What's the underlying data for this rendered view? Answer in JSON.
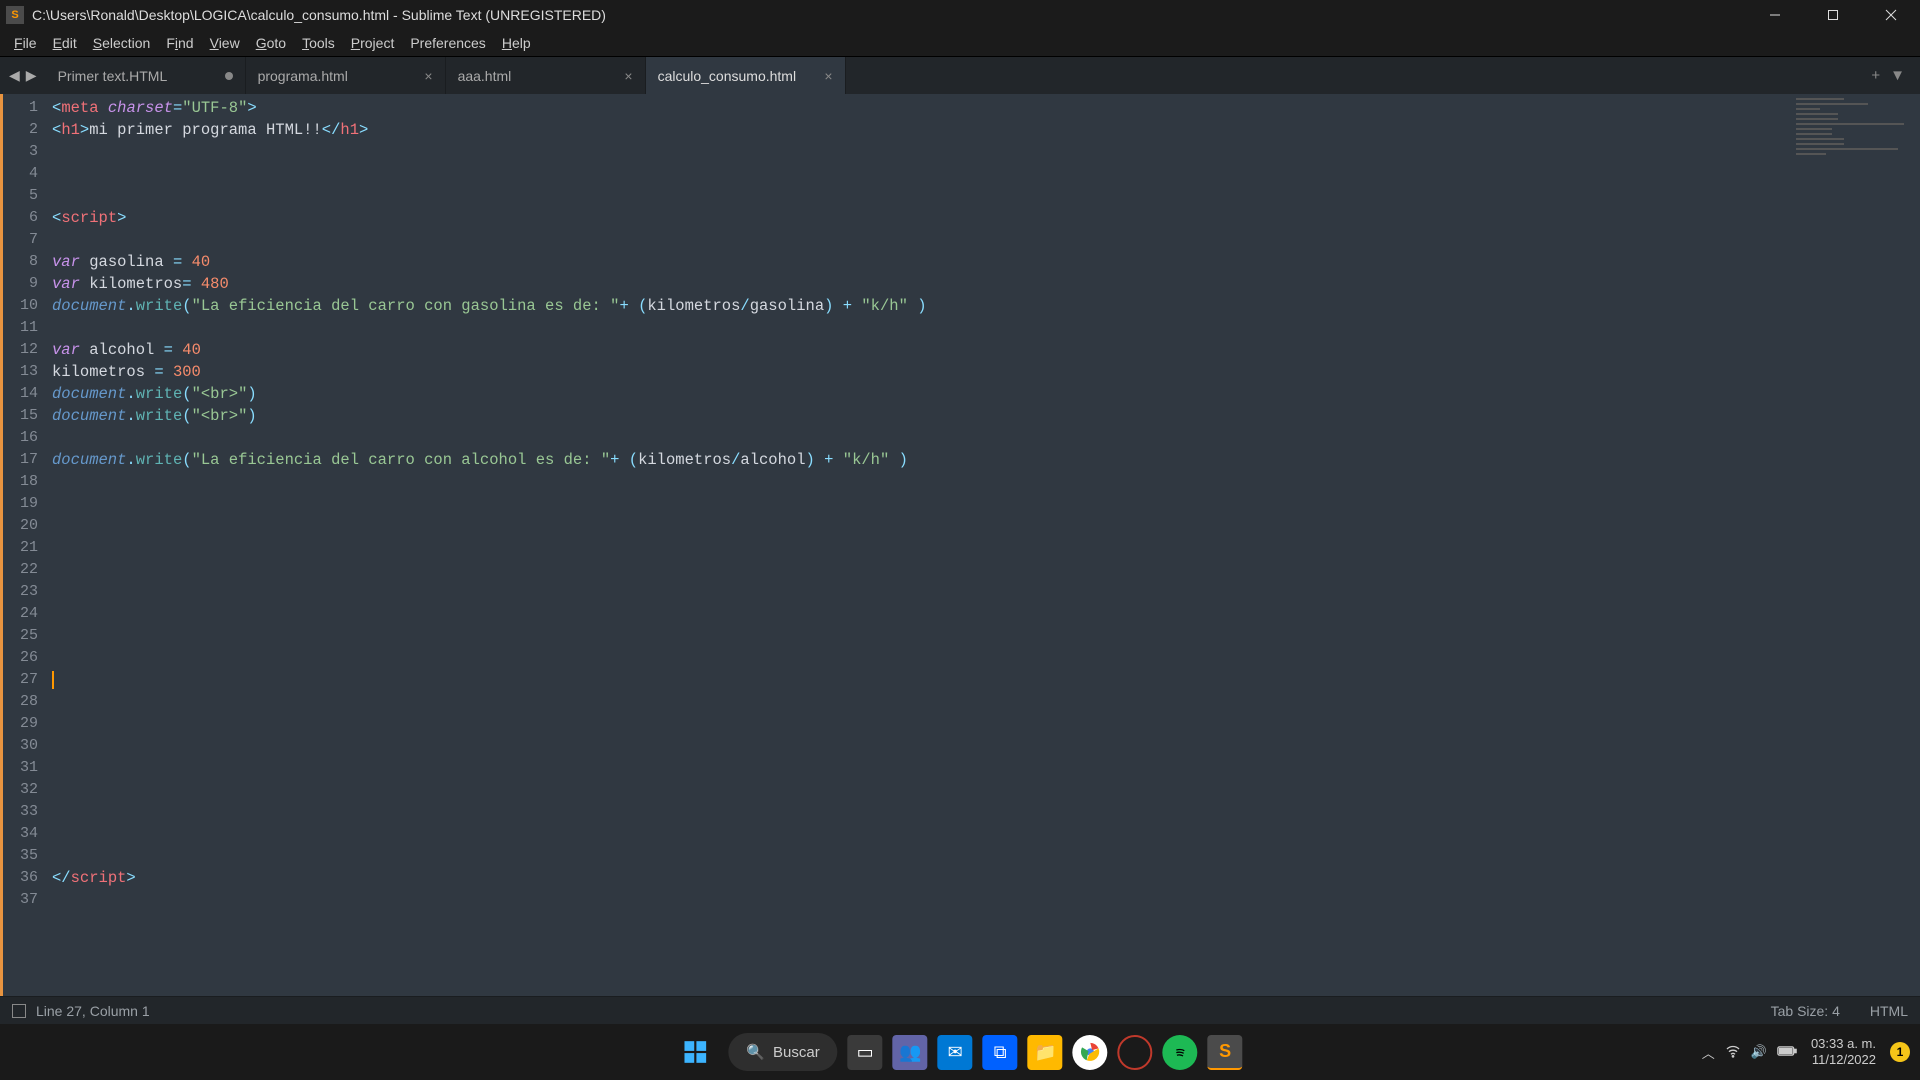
{
  "titlebar": {
    "path": "C:\\Users\\Ronald\\Desktop\\LOGICA\\calculo_consumo.html - Sublime Text (UNREGISTERED)",
    "app_icon_letter": "S"
  },
  "menus": [
    "File",
    "Edit",
    "Selection",
    "Find",
    "View",
    "Goto",
    "Tools",
    "Project",
    "Preferences",
    "Help"
  ],
  "tabs": [
    {
      "label": "Primer text.HTML",
      "dirty": true,
      "active": false
    },
    {
      "label": "programa.html",
      "dirty": false,
      "active": false
    },
    {
      "label": "aaa.html",
      "dirty": false,
      "active": false
    },
    {
      "label": "calculo_consumo.html",
      "dirty": false,
      "active": true
    }
  ],
  "code_lines": 37,
  "cursor_line": 27,
  "statusbar": {
    "position": "Line 27, Column 1",
    "tabsize": "Tab Size: 4",
    "syntax": "HTML"
  },
  "code_source": {
    "1": "<meta charset=\"UTF-8\">",
    "2": "<h1>mi primer programa HTML!!</h1>",
    "6": "<script>",
    "8": "var gasolina = 40",
    "9": "var kilometros= 480",
    "10": "document.write(\"La eficiencia del carro con gasolina es de: \"+ (kilometros/gasolina) + \"k/h\" )",
    "12": "var alcohol = 40",
    "13": "kilometros = 300",
    "14": "document.write(\"<br>\")",
    "15": "document.write(\"<br>\")",
    "17": "document.write(\"La eficiencia del carro con alcohol es de: \"+ (kilometros/alcohol) + \"k/h\" )",
    "36": "</script>"
  },
  "taskbar": {
    "search_label": "Buscar",
    "time": "03:33 a. m.",
    "date": "11/12/2022",
    "notif_count": "1"
  }
}
